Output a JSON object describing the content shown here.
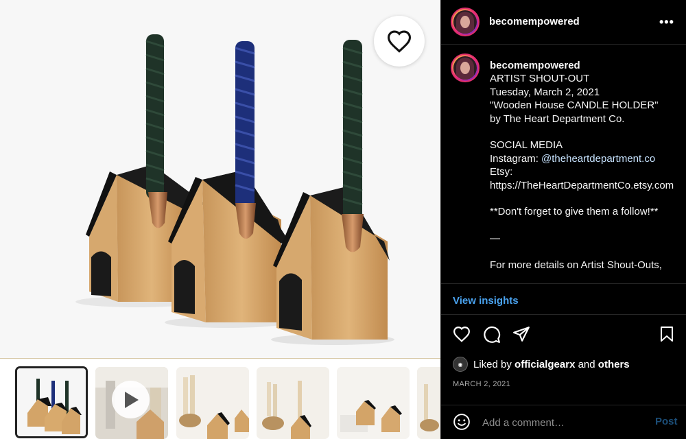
{
  "post": {
    "username": "becomempowered",
    "more_icon": "more-horizontal-icon",
    "caption_lines": [
      "ARTIST SHOUT-OUT",
      "Tuesday, March 2, 2021",
      "\"Wooden House CANDLE HOLDER\"",
      "by The Heart Department Co.",
      "",
      "SOCIAL MEDIA",
      "Instagram: ",
      "Etsy:",
      "https://TheHeartDepartmentCo.etsy.com",
      "",
      "**Don't forget to give them a follow!**",
      "",
      "—",
      "",
      "For more details on Artist Shout-Outs,"
    ],
    "mention": "@theheartdepartment.co",
    "view_insights": "View insights",
    "liked_by_prefix": "Liked by ",
    "liked_by_user": "officialgearx",
    "liked_by_and": " and ",
    "liked_by_others": "others",
    "date": "MARCH 2, 2021",
    "comment_placeholder": "Add a comment…",
    "post_label": "Post"
  },
  "icons": {
    "like": "heart-outline-icon",
    "comment": "comment-bubble-icon",
    "share": "paper-plane-icon",
    "save": "bookmark-icon",
    "emoji": "smiley-face-icon",
    "overlay_like": "heart-outline-icon",
    "play": "play-icon"
  },
  "colors": {
    "panel_bg": "#000000",
    "link_blue": "#4aa3f0",
    "divider": "#262626",
    "muted": "#a8a8a8"
  }
}
